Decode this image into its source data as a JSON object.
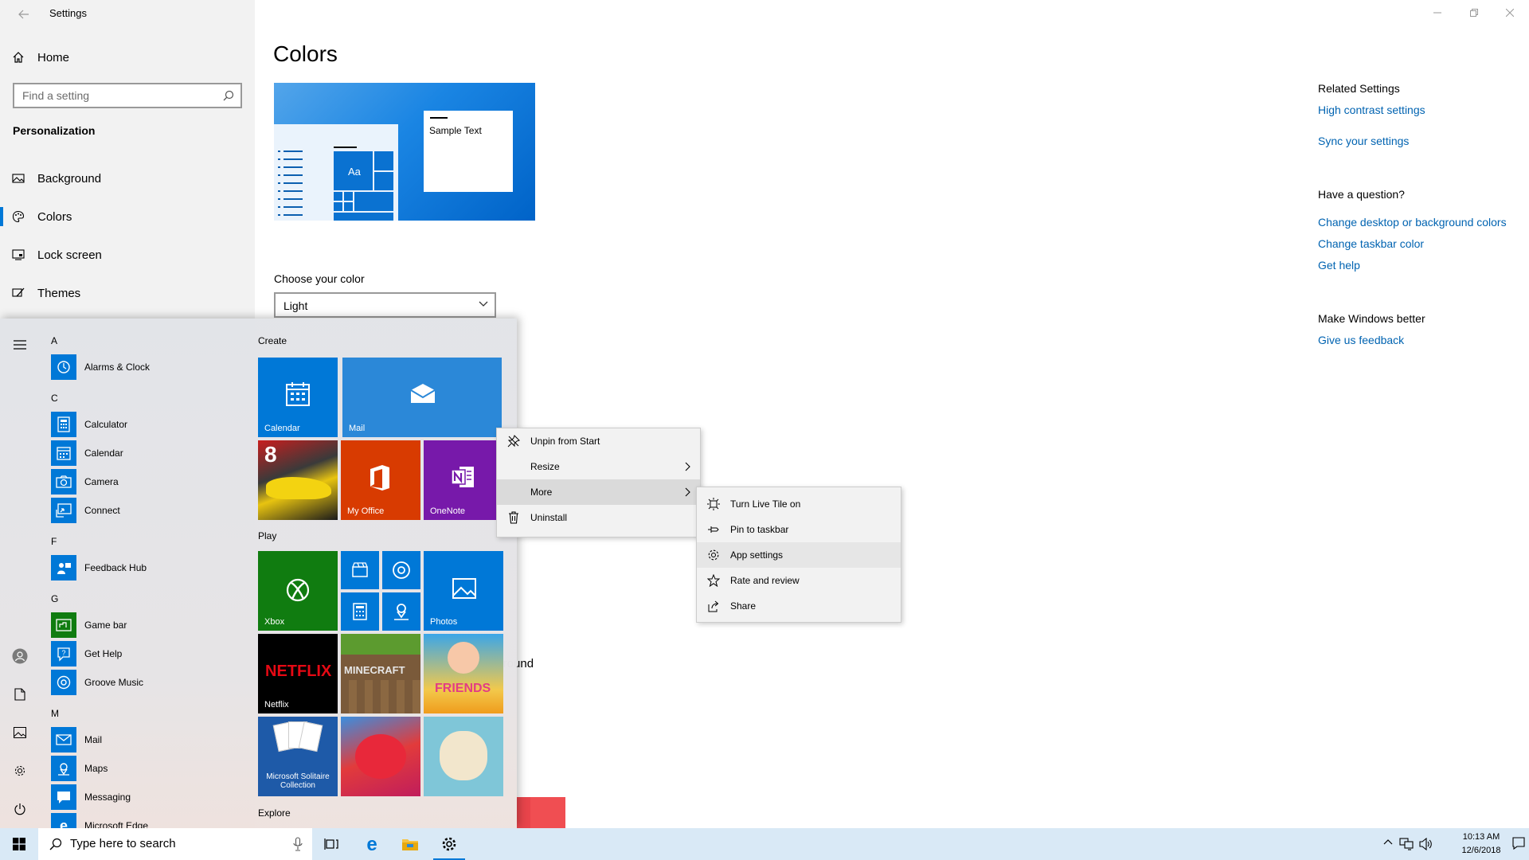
{
  "window": {
    "title": "Settings",
    "minimize": "—",
    "restore": "❐",
    "close": "✕"
  },
  "sidebar": {
    "home": "Home",
    "search_placeholder": "Find a setting",
    "section": "Personalization",
    "items": [
      {
        "label": "Background",
        "icon": "picture-icon"
      },
      {
        "label": "Colors",
        "icon": "palette-icon",
        "active": true
      },
      {
        "label": "Lock screen",
        "icon": "lock-screen-icon"
      },
      {
        "label": "Themes",
        "icon": "brush-icon"
      }
    ]
  },
  "main": {
    "title": "Colors",
    "preview_sample_text": "Sample Text",
    "preview_tile_text": "Aa",
    "choose_color_label": "Choose your color",
    "choose_color_value": "Light",
    "partial_text": "ackground"
  },
  "related": {
    "heading": "Related Settings",
    "links": [
      "High contrast settings",
      "Sync your settings"
    ],
    "question_heading": "Have a question?",
    "question_links": [
      "Change desktop or background colors",
      "Change taskbar color",
      "Get help"
    ],
    "better_heading": "Make Windows better",
    "feedback_link": "Give us feedback"
  },
  "start_menu": {
    "app_list": [
      {
        "letter": "A",
        "apps": [
          "Alarms & Clock"
        ]
      },
      {
        "letter": "C",
        "apps": [
          "Calculator",
          "Calendar",
          "Camera",
          "Connect"
        ]
      },
      {
        "letter": "F",
        "apps": [
          "Feedback Hub"
        ]
      },
      {
        "letter": "G",
        "apps": [
          "Game bar",
          "Get Help",
          "Groove Music"
        ]
      },
      {
        "letter": "M",
        "apps": [
          "Mail",
          "Maps",
          "Messaging",
          "Microsoft Edge"
        ]
      }
    ],
    "groups": {
      "create": "Create",
      "play": "Play",
      "explore": "Explore"
    },
    "tiles": {
      "calendar": "Calendar",
      "mail": "Mail",
      "my_office": "My Office",
      "onenote": "OneNote",
      "xbox": "Xbox",
      "photos": "Photos",
      "netflix": "Netflix",
      "netflix_logo": "NETFLIX",
      "minecraft_logo": "MINECRAFT",
      "friends_logo": "FRIENDS",
      "solitaire": "Microsoft Solitaire Collection",
      "asphalt_number": "8"
    }
  },
  "context_menu": {
    "items": [
      "Unpin from Start",
      "Resize",
      "More",
      "Uninstall"
    ]
  },
  "more_submenu": {
    "items": [
      "Turn Live Tile on",
      "Pin to taskbar",
      "App settings",
      "Rate and review",
      "Share"
    ]
  },
  "taskbar": {
    "search_text": "Type here to search",
    "time": "10:13 AM",
    "date": "12/6/2018"
  },
  "colors": {
    "accent": "#0078d7",
    "link": "#0063b1",
    "xbox_green": "#107c10",
    "office_orange": "#d83b01",
    "onenote_purple": "#7719aa"
  }
}
